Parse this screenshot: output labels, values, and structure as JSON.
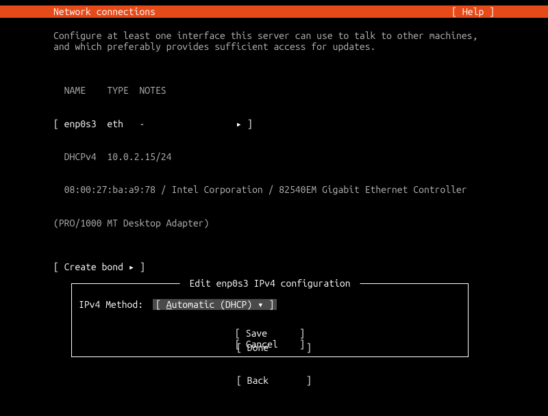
{
  "header": {
    "title": "Network connections",
    "help": "[ Help ]"
  },
  "intro": {
    "line1": "Configure at least one interface this server can use to talk to other machines,",
    "line2": "and which preferably provides sufficient access for updates."
  },
  "iface_table": {
    "header": "  NAME    TYPE  NOTES",
    "row": "[ enp0s3  eth   -                 ▸ ]",
    "dhcp": "  DHCPv4  10.0.2.15/24",
    "mac": "  08:00:27:ba:a9:78 / Intel Corporation / 82540EM Gigabit Ethernet Controller",
    "mac2": "(PRO/1000 MT Desktop Adapter)"
  },
  "create_bond": "[ Create bond ▸ ]",
  "dialog": {
    "title": " Edit enp0s3 IPv4 configuration ",
    "field_label": "IPv4 Method:",
    "dropdown_prefix": "[ ",
    "dropdown_underline": "A",
    "dropdown_rest": "utomatic (DHCP) ▾ ]",
    "save": "[ Save      ]",
    "cancel": "[ Cancel    ]"
  },
  "bottom": {
    "done": "[ Done       ]",
    "back": "[ Back       ]"
  }
}
